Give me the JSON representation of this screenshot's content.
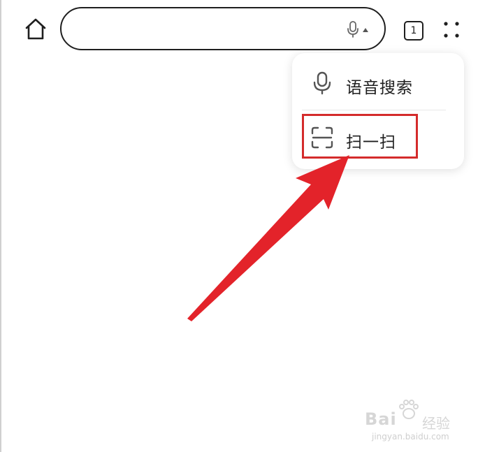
{
  "toolbar": {
    "search_value": "",
    "tab_count": "1"
  },
  "popup_menu": {
    "items": [
      {
        "label": "语音搜索",
        "icon": "microphone-icon"
      },
      {
        "label": "扫一扫",
        "icon": "scan-icon"
      }
    ],
    "highlighted_index": 1
  },
  "annotation": {
    "highlight_color": "#d42b2b",
    "arrow_color": "#e3232a"
  },
  "watermark": {
    "brand": "Bai",
    "brand_suffix": "经验",
    "url": "jingyan.baidu.com"
  }
}
